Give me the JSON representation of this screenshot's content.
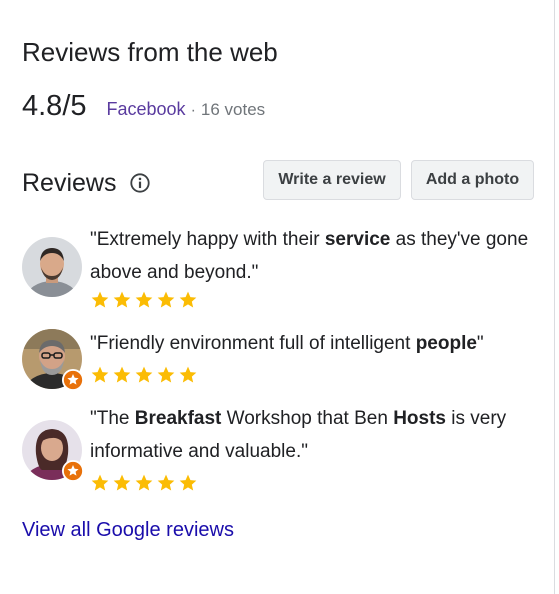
{
  "web_reviews": {
    "title": "Reviews from the web",
    "score": "4.8/5",
    "source": "Facebook",
    "separator": "·",
    "votes": "16 votes"
  },
  "reviews_section": {
    "title": "Reviews",
    "info_icon": "info-icon",
    "write_review_label": "Write a review",
    "add_photo_label": "Add a photo"
  },
  "reviews": [
    {
      "avatar_icon": "reviewer-avatar",
      "local_guide_badge": false,
      "stars": 5,
      "parts": [
        "\"Extremely happy with their ",
        "service",
        " as they've gone above and beyond.\""
      ]
    },
    {
      "avatar_icon": "reviewer-avatar",
      "local_guide_badge": true,
      "stars": 5,
      "parts": [
        "\"Friendly environment full of intelligent ",
        "people",
        "\""
      ]
    },
    {
      "avatar_icon": "reviewer-avatar",
      "local_guide_badge": true,
      "stars": 5,
      "parts": [
        "\"The ",
        "Breakfast",
        " Workshop that Ben ",
        "Hosts",
        " is very informative and valuable.\""
      ]
    }
  ],
  "view_all_label": "View all Google reviews",
  "colors": {
    "star": "#fbbc04",
    "link": "#1a0dab",
    "source_link": "#5a3b9f",
    "badge": "#e8710a"
  }
}
